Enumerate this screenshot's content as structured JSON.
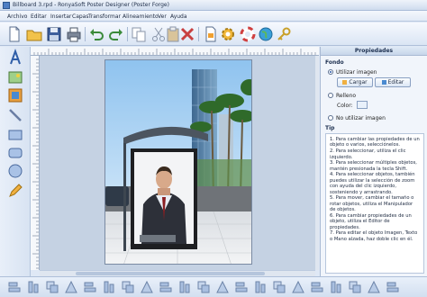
{
  "window": {
    "title": "Billboard 3.rpd - RonyaSoft Poster Designer (Poster Forge)"
  },
  "menu": {
    "items": [
      "Archivo",
      "Editar",
      "Insertar",
      "Capas",
      "Transformar",
      "Alineamiento",
      "Ver",
      "Ayuda"
    ]
  },
  "toolbar": {
    "buttons": [
      "new-document-icon",
      "open-folder-icon",
      "save-icon",
      "print-icon",
      "undo-icon",
      "redo-icon",
      "copy-icon",
      "cut-icon",
      "paste-icon",
      "delete-icon",
      "export-icon",
      "settings-gear-icon",
      "help-lifebuoy-icon",
      "web-globe-icon",
      "key-icon"
    ]
  },
  "left_tools": [
    "text-tool-icon",
    "image-tool-icon",
    "clipart-tool-icon",
    "line-tool-icon",
    "rectangle-tool-icon",
    "rounded-rectangle-tool-icon",
    "ellipse-tool-icon",
    "pencil-tool-icon"
  ],
  "properties": {
    "header": "Propiedades",
    "fondo_label": "Fondo",
    "use_image_label": "Utilizar imagen",
    "load_button": "Cargar",
    "edit_button": "Editar",
    "fill_label": "Relleno",
    "color_label": "Color:",
    "no_image_label": "No utilizar imagen",
    "tip_label": "Tip",
    "tips": [
      "1. Para cambiar las propiedades de un objeto o varios, selecciónelos.",
      "2. Para seleccionar, utiliza el clic izquierdo.",
      "3. Para seleccionar múltiples objetos, mantén presionada la tecla Shift.",
      "4. Para seleccionar objetos, también puedes utilizar la selección de zoom con ayuda del clic izquierdo, sosteniendo y arrastrando.",
      "5. Para mover, cambiar el tamaño o rotar objetos, utiliza el Manipulador de objetos.",
      "6. Para cambiar propiedades de un objeto, utiliza el Editor de propiedades.",
      "7. Para editar el objeto Imagen, Texto o Mano alzada, haz doble clic en él."
    ]
  },
  "colors": {
    "accent": "#2456a8",
    "panel_bg": "#f1f5fb",
    "canvas_bg": "#c5d2e3"
  },
  "bottom_toolbar": {
    "buttons": [
      "align-left-icon",
      "align-center-icon",
      "align-right-icon",
      "align-top-icon",
      "align-middle-icon",
      "align-bottom-icon",
      "bring-front-icon",
      "send-back-icon",
      "group-icon",
      "ungroup-icon",
      "flip-horizontal-icon",
      "flip-vertical-icon",
      "rotate-left-icon",
      "rotate-right-icon",
      "lock-icon",
      "unlock-icon",
      "distribute-h-icon",
      "distribute-v-icon",
      "same-width-icon",
      "same-height-icon",
      "center-page-icon"
    ]
  }
}
